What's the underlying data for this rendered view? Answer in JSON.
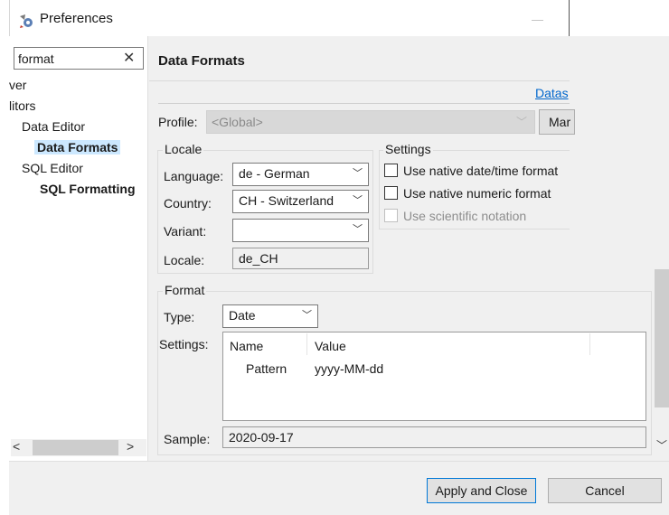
{
  "window": {
    "title": "Preferences",
    "minimize_glyph": "—"
  },
  "sidebar": {
    "filter": {
      "value": "format",
      "clear_glyph": "✕"
    },
    "items": [
      {
        "label": "ver"
      },
      {
        "label": "litors"
      },
      {
        "label": "Data Editor"
      },
      {
        "label": "Data Formats",
        "selected": true
      },
      {
        "label": "SQL Editor"
      },
      {
        "label": "SQL Formatting"
      }
    ],
    "scroll_left": "<",
    "scroll_right": ">"
  },
  "page": {
    "title": "Data Formats",
    "link": "Datas",
    "profile": {
      "label": "Profile:",
      "value": "<Global>",
      "manage_button": "Mar"
    },
    "locale": {
      "group": "Locale",
      "language_label": "Language:",
      "language_value": "de - German",
      "country_label": "Country:",
      "country_value": "CH - Switzerland",
      "variant_label": "Variant:",
      "variant_value": "",
      "locale_label": "Locale:",
      "locale_value": "de_CH"
    },
    "settings": {
      "group": "Settings",
      "native_datetime": "Use native date/time format",
      "native_numeric": "Use native numeric format",
      "scientific": "Use scientific notation"
    },
    "format": {
      "group": "Format",
      "type_label": "Type:",
      "type_value": "Date",
      "settings_label": "Settings:",
      "columns": [
        "Name",
        "Value"
      ],
      "rows": [
        {
          "name": "Pattern",
          "value": "yyyy-MM-dd"
        }
      ],
      "sample_label": "Sample:",
      "sample_value": "2020-09-17"
    }
  },
  "buttons": {
    "apply_close": "Apply and Close",
    "cancel": "Cancel"
  },
  "background_window": {
    "arrow": "<"
  },
  "colors": {
    "accent": "#0078d7",
    "selection": "#cce8ff",
    "link": "#0066cc"
  }
}
